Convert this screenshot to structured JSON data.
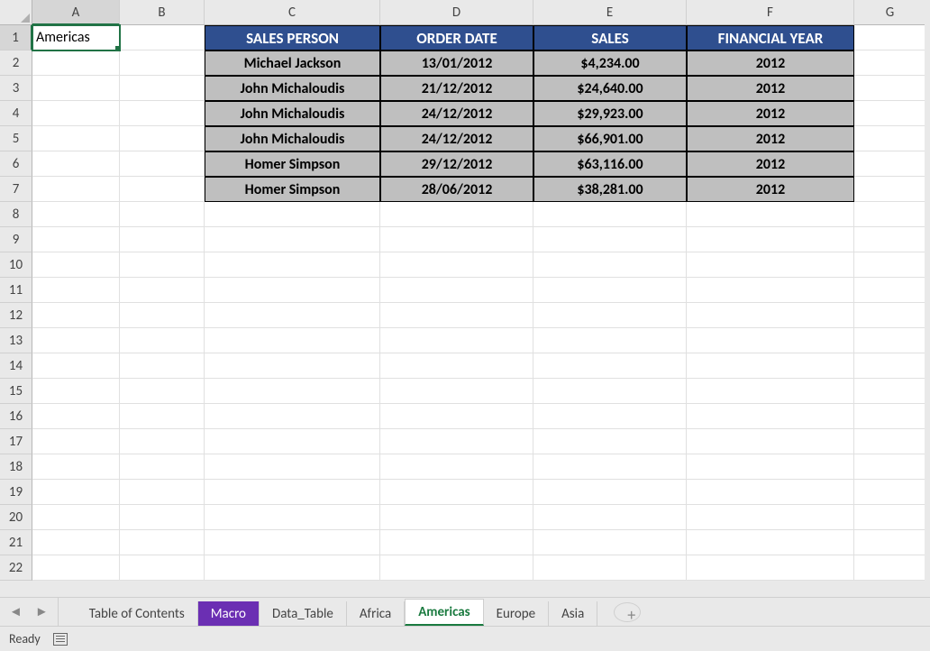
{
  "columns": [
    "A",
    "B",
    "C",
    "D",
    "E",
    "F",
    "G"
  ],
  "row_count": 22,
  "active_cell": {
    "row": 1,
    "col": "A",
    "value": "Americas"
  },
  "table": {
    "headers": [
      "SALES PERSON",
      "ORDER DATE",
      "SALES",
      "FINANCIAL YEAR"
    ],
    "rows": [
      {
        "person": "Michael Jackson",
        "date": "13/01/2012",
        "sales": "$4,234.00",
        "fy": "2012"
      },
      {
        "person": "John Michaloudis",
        "date": "21/12/2012",
        "sales": "$24,640.00",
        "fy": "2012"
      },
      {
        "person": "John Michaloudis",
        "date": "24/12/2012",
        "sales": "$29,923.00",
        "fy": "2012"
      },
      {
        "person": "John Michaloudis",
        "date": "24/12/2012",
        "sales": "$66,901.00",
        "fy": "2012"
      },
      {
        "person": "Homer Simpson",
        "date": "29/12/2012",
        "sales": "$63,116.00",
        "fy": "2012"
      },
      {
        "person": "Homer Simpson",
        "date": "28/06/2012",
        "sales": "$38,281.00",
        "fy": "2012"
      }
    ]
  },
  "tabs": [
    {
      "label": "Table of Contents",
      "active": false,
      "color": null
    },
    {
      "label": "Macro",
      "active": false,
      "color": "#6b2fb3"
    },
    {
      "label": "Data_Table",
      "active": false,
      "color": null
    },
    {
      "label": "Africa",
      "active": false,
      "color": null
    },
    {
      "label": "Americas",
      "active": true,
      "color": null
    },
    {
      "label": "Europe",
      "active": false,
      "color": null
    },
    {
      "label": "Asia",
      "active": false,
      "color": null
    }
  ],
  "status": {
    "text": "Ready"
  }
}
